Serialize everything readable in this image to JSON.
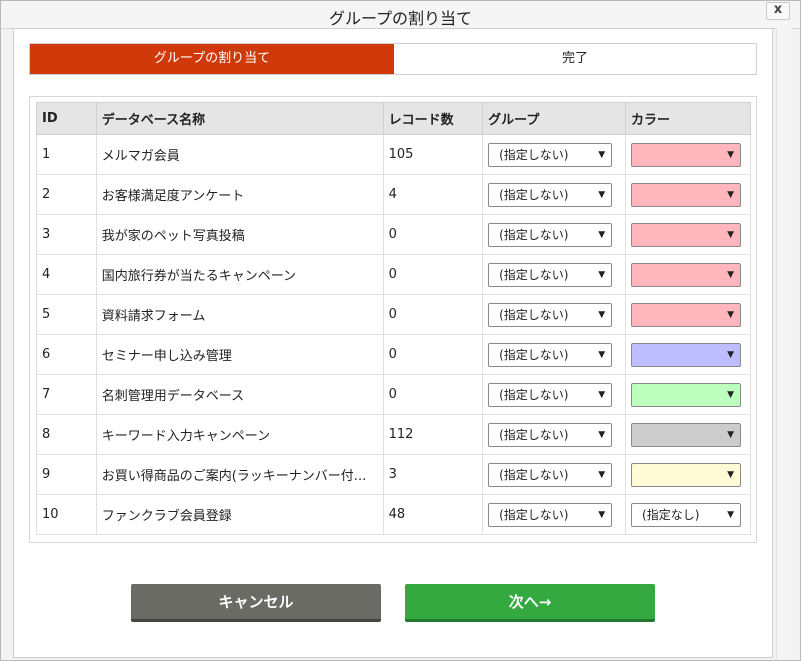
{
  "window": {
    "title": "グループの割り当て",
    "close_label": "x"
  },
  "steps": [
    {
      "label": "グループの割り当て",
      "active": true
    },
    {
      "label": "完了",
      "active": false
    }
  ],
  "table": {
    "headers": {
      "id": "ID",
      "name": "データベース名称",
      "count": "レコード数",
      "group": "グループ",
      "color": "カラー"
    },
    "rows": [
      {
        "id": "1",
        "name": "メルマガ会員",
        "count": "105",
        "group": "(指定しない)",
        "color_value": "",
        "color_hex": "#ffb7bd"
      },
      {
        "id": "2",
        "name": "お客様満足度アンケート",
        "count": "4",
        "group": "(指定しない)",
        "color_value": "",
        "color_hex": "#ffb7bd"
      },
      {
        "id": "3",
        "name": "我が家のペット写真投稿",
        "count": "0",
        "group": "(指定しない)",
        "color_value": "",
        "color_hex": "#ffb7bd"
      },
      {
        "id": "4",
        "name": "国内旅行券が当たるキャンペーン",
        "count": "0",
        "group": "(指定しない)",
        "color_value": "",
        "color_hex": "#ffb7bd"
      },
      {
        "id": "5",
        "name": "資料請求フォーム",
        "count": "0",
        "group": "(指定しない)",
        "color_value": "",
        "color_hex": "#ffb7bd"
      },
      {
        "id": "6",
        "name": "セミナー申し込み管理",
        "count": "0",
        "group": "(指定しない)",
        "color_value": "",
        "color_hex": "#bdbdff"
      },
      {
        "id": "7",
        "name": "名刺管理用データベース",
        "count": "0",
        "group": "(指定しない)",
        "color_value": "",
        "color_hex": "#bdffbd"
      },
      {
        "id": "8",
        "name": "キーワード入力キャンペーン",
        "count": "112",
        "group": "(指定しない)",
        "color_value": "",
        "color_hex": "#cccccc"
      },
      {
        "id": "9",
        "name": "お買い得商品のご案内(ラッキーナンバー付...",
        "count": "3",
        "group": "(指定しない)",
        "color_value": "",
        "color_hex": "#fffbd6"
      },
      {
        "id": "10",
        "name": "ファンクラブ会員登録",
        "count": "48",
        "group": "(指定しない)",
        "color_value": "(指定なし)",
        "color_hex": "#ffffff"
      }
    ],
    "dropdown_arrow": "▼"
  },
  "buttons": {
    "cancel": "キャンセル",
    "next": "次へ→"
  }
}
